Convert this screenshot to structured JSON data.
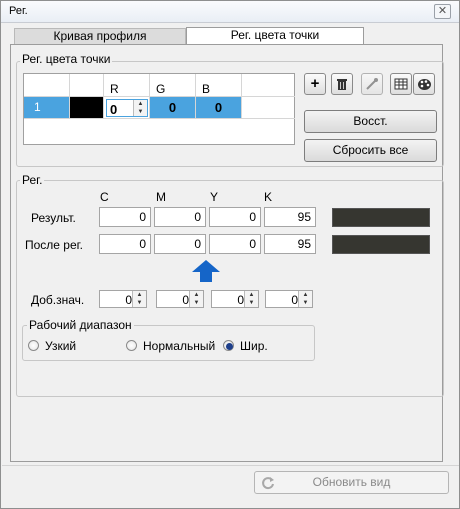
{
  "window": {
    "title": "Рег.",
    "close_glyph": "✕"
  },
  "tabs": [
    {
      "label": "Кривая профиля"
    },
    {
      "label": "Рег. цвета точки"
    }
  ],
  "point_group": {
    "label": "Рег. цвета точки",
    "columns": [
      "",
      "",
      "R",
      "G",
      "B"
    ],
    "row": {
      "index": "1",
      "color": "#000000",
      "r": "0",
      "g": "0",
      "b": "0"
    },
    "buttons": {
      "restore": "Восст.",
      "reset_all": "Сбросить все"
    },
    "icons": [
      "add-icon",
      "delete-icon",
      "eyedropper-icon",
      "table-icon",
      "palette-icon"
    ]
  },
  "reg_group": {
    "label": "Рег.",
    "columns": [
      "C",
      "M",
      "Y",
      "K"
    ],
    "result": {
      "label": "Результ.",
      "values": [
        "0",
        "0",
        "0",
        "95"
      ],
      "color": "#363630"
    },
    "after": {
      "label": "После рег.",
      "values": [
        "0",
        "0",
        "0",
        "95"
      ],
      "color": "#363630"
    },
    "add": {
      "label": "Доб.знач.",
      "values": [
        "0",
        "0",
        "0",
        "0"
      ]
    },
    "range": {
      "label": "Рабочий диапазон",
      "options": [
        "Узкий",
        "Нормальный",
        "Шир."
      ],
      "selected": "Шир."
    }
  },
  "footer": {
    "update_view": "Обновить вид"
  },
  "colors": {
    "selection": "#4aa3df",
    "arrow": "#1565c8"
  }
}
